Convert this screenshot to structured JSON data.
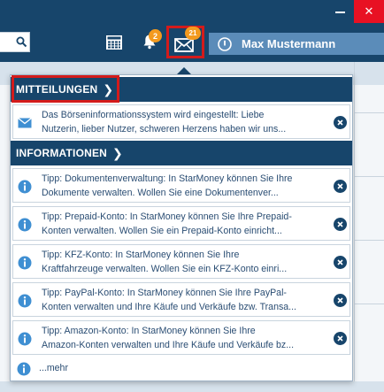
{
  "window": {
    "minimize_label": "",
    "close_label": "✕"
  },
  "toolbar": {
    "bell_count": "2",
    "mail_count": "21",
    "user_name": "Max Mustermann"
  },
  "popup": {
    "mitteilungen_header": "MITTEILUNGEN",
    "informationen_header": "INFORMATIONEN",
    "mitteilungen": [
      {
        "line1": "Das Börseninformationssystem wird eingestellt: Liebe",
        "line2": "Nutzerin, lieber Nutzer,  schweren Herzens haben wir uns..."
      }
    ],
    "informationen": [
      {
        "line1": "Tipp: Dokumentenverwaltung: In StarMoney können Sie Ihre",
        "line2": "Dokumente verwalten.    Wollen Sie eine Dokumentenver..."
      },
      {
        "line1": "Tipp: Prepaid-Konto: In StarMoney können Sie Ihre Prepaid-",
        "line2": "Konten verwalten.     Wollen Sie ein Prepaid-Konto einricht..."
      },
      {
        "line1": "Tipp: KFZ-Konto: In StarMoney können Sie Ihre",
        "line2": "Kraftfahrzeuge verwalten.     Wollen Sie ein KFZ-Konto einri..."
      },
      {
        "line1": "Tipp: PayPal-Konto: In StarMoney können Sie Ihre PayPal-",
        "line2": "Konten verwalten und Ihre Käufe und Verkäufe bzw. Transa..."
      },
      {
        "line1": "Tipp: Amazon-Konto: In StarMoney können Sie Ihre",
        "line2": "Amazon-Konten verwalten und Ihre Käufe und Verkäufe bz..."
      }
    ],
    "more_label": "...mehr"
  },
  "colors": {
    "navy": "#17456b",
    "accent_blue": "#5b8cb9",
    "highlight_red": "#d41b1b",
    "badge_orange": "#f39a1e",
    "text_blue": "#2a4d73"
  },
  "icons": {
    "search": "search-icon",
    "calculator": "calculator-icon",
    "bell": "bell-icon",
    "mail": "mail-icon",
    "power": "power-icon",
    "info": "info-icon",
    "envelope": "envelope-icon",
    "close": "close-icon",
    "chevron": "chevron-right-icon"
  }
}
